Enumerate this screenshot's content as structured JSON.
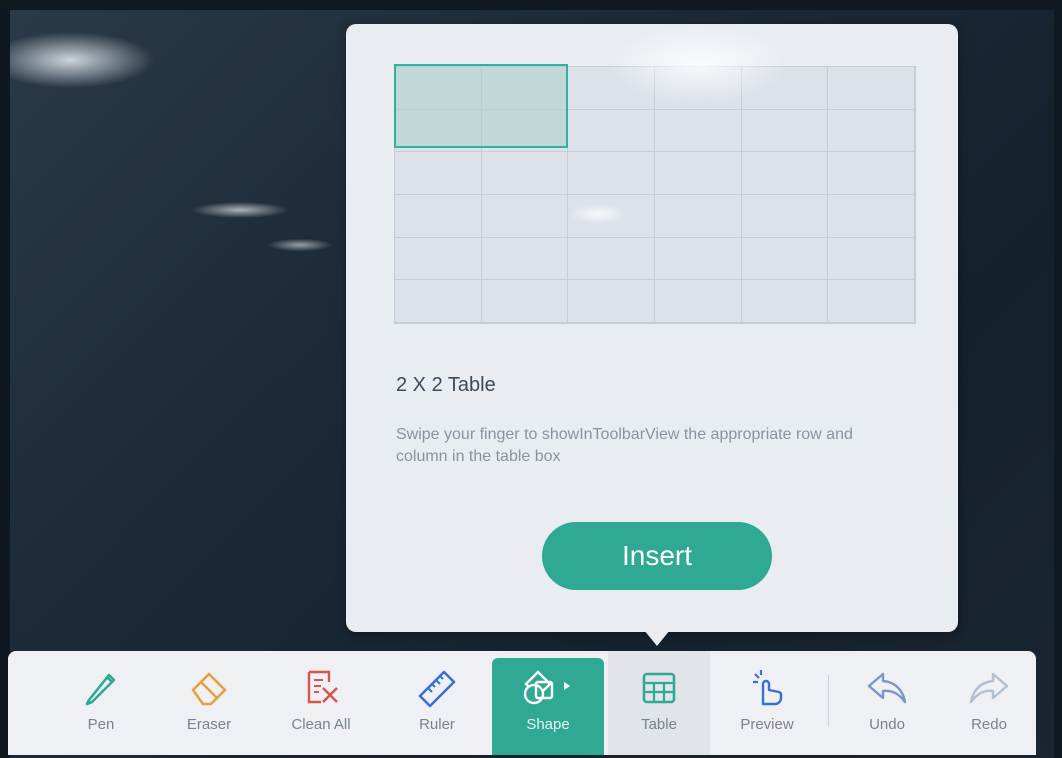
{
  "table_popup": {
    "title": "2 X 2 Table",
    "description": "Swipe your finger to showInToolbarView the appropriate row and column in the table box",
    "insert_label": "Insert",
    "grid": {
      "rows": 6,
      "cols": 6,
      "selected_rows": 2,
      "selected_cols": 2
    }
  },
  "toolbar": {
    "items": [
      {
        "label": "Pen",
        "icon": "pen-icon"
      },
      {
        "label": "Eraser",
        "icon": "eraser-icon"
      },
      {
        "label": "Clean All",
        "icon": "clean-all-icon"
      },
      {
        "label": "Ruler",
        "icon": "ruler-icon"
      },
      {
        "label": "Shape",
        "icon": "shape-icon"
      },
      {
        "label": "Table",
        "icon": "table-icon"
      },
      {
        "label": "Preview",
        "icon": "preview-icon"
      },
      {
        "label": "Undo",
        "icon": "undo-icon"
      },
      {
        "label": "Redo",
        "icon": "redo-icon"
      }
    ]
  },
  "colors": {
    "accent": "#2fa894",
    "eraser": "#e5a23a",
    "clean_all": "#d9534f",
    "ruler": "#3b6fd1"
  }
}
